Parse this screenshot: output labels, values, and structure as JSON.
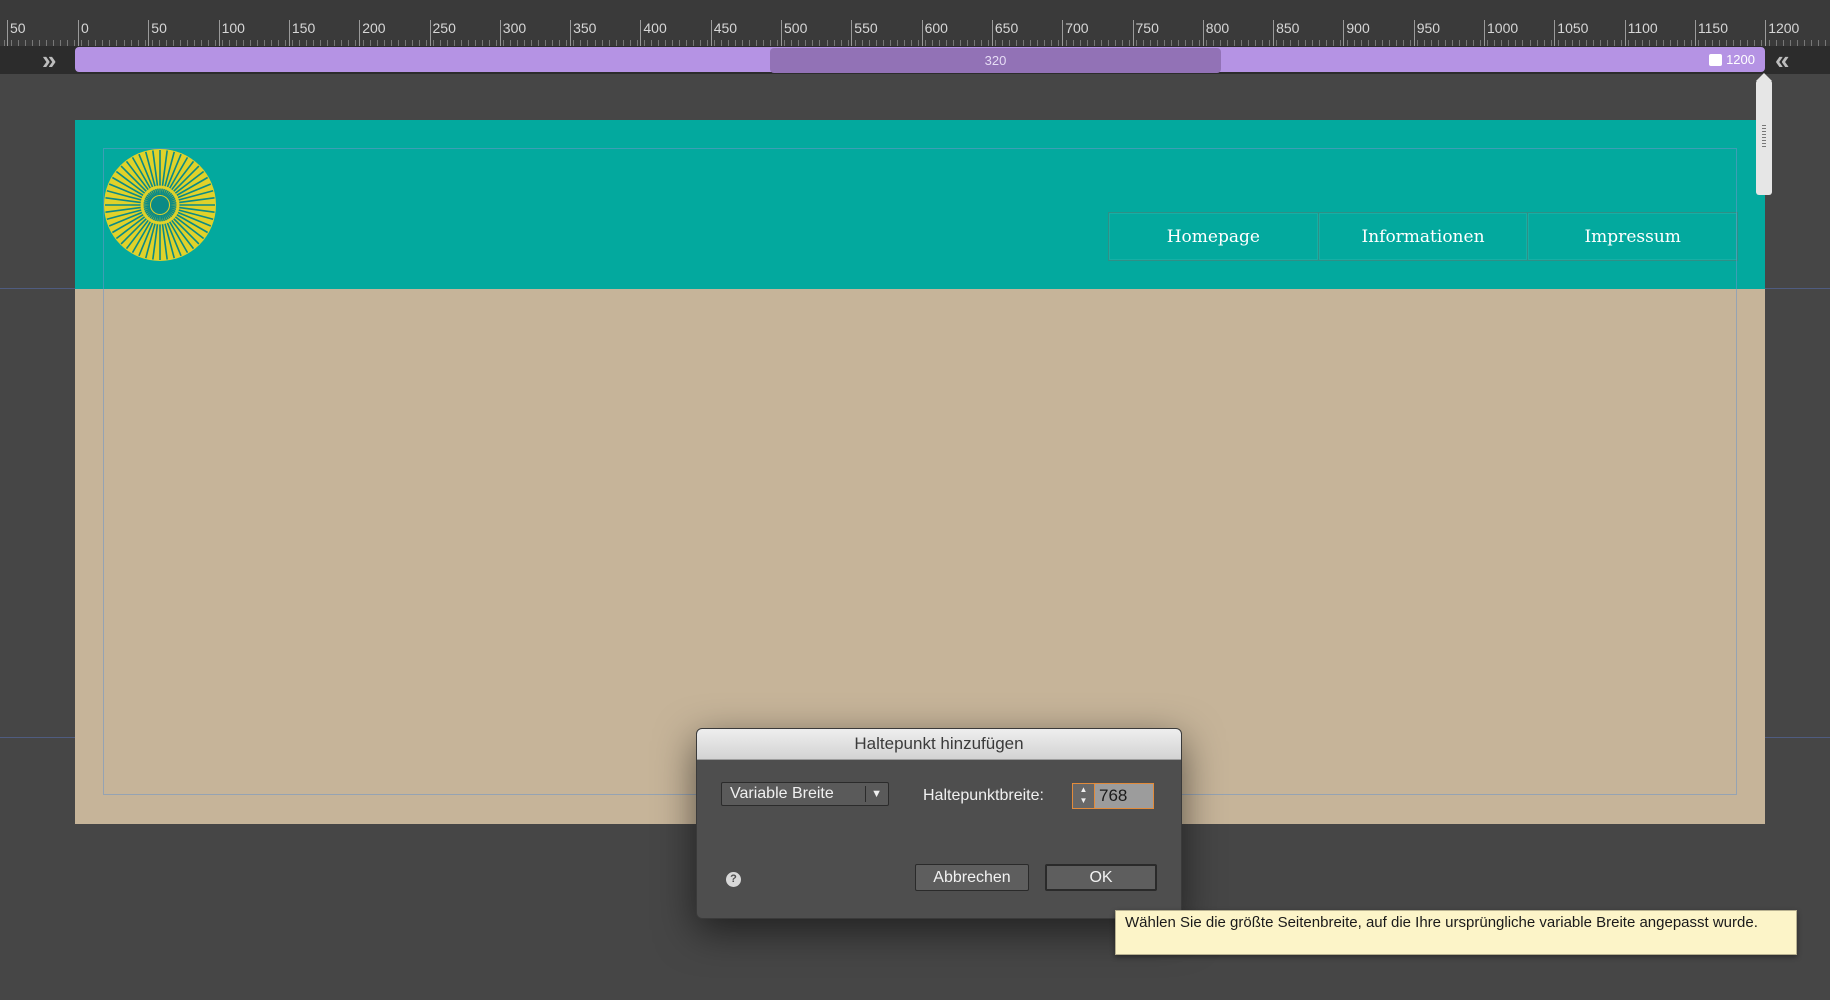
{
  "ruler": {
    "labels": [
      "50",
      "0",
      "50",
      "100",
      "150",
      "200",
      "250",
      "300",
      "350",
      "400",
      "450",
      "500",
      "550",
      "600",
      "650",
      "700",
      "750",
      "800",
      "850",
      "900",
      "950",
      "1000",
      "1050",
      "1100",
      "1150",
      "1200"
    ]
  },
  "breakpoint_bar": {
    "min_label": "320",
    "max_label": "1200"
  },
  "site": {
    "nav_items": [
      "Homepage",
      "Informationen",
      "Impressum"
    ]
  },
  "dialog": {
    "title": "Haltepunkt hinzufügen",
    "select_value": "Variable Breite",
    "field_label": "Haltepunktbreite:",
    "field_value": "768",
    "help_symbol": "?",
    "cancel_label": "Abbrechen",
    "ok_label": "OK"
  },
  "tooltip": {
    "text": "Wählen Sie die größte Seitenbreite, auf die Ihre ursprüngliche variable Breite angepasst wurde."
  },
  "colors": {
    "header": "#03a99e",
    "body": "#c6b499",
    "breakpoint_bar": "#b593e4",
    "logo_yellow": "#e0d22a",
    "logo_teal": "#0b8a86"
  },
  "icons": {
    "bar_left": "double-chevron-right-icon",
    "bar_right": "double-chevron-left-icon",
    "logo": "sunburst-logo-icon"
  }
}
